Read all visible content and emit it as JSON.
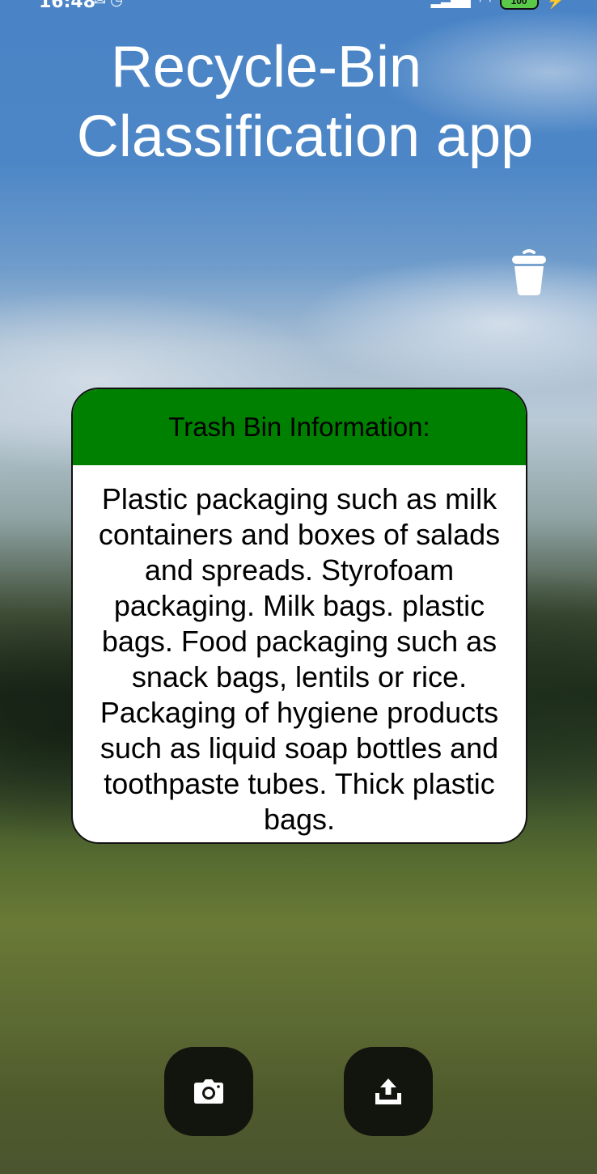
{
  "status_bar": {
    "time": "16:48",
    "battery": "100"
  },
  "app": {
    "title_line1": "Recycle-Bin",
    "title_line2": "Classification app"
  },
  "info_card": {
    "header": "Trash Bin Information:",
    "body": "Plastic packaging such as milk containers and boxes of salads and spreads. Styrofoam packaging. Milk bags. plastic bags. Food packaging such as snack bags, lentils or rice. Packaging of hygiene products such as liquid soap bottles and toothpaste tubes. Thick plastic bags."
  },
  "icons": {
    "trash": "trash-can-icon",
    "camera": "camera-icon",
    "upload": "upload-icon"
  },
  "colors": {
    "card_header": "#008000",
    "button_bg": "#12140e",
    "title_text": "#ffffff"
  }
}
